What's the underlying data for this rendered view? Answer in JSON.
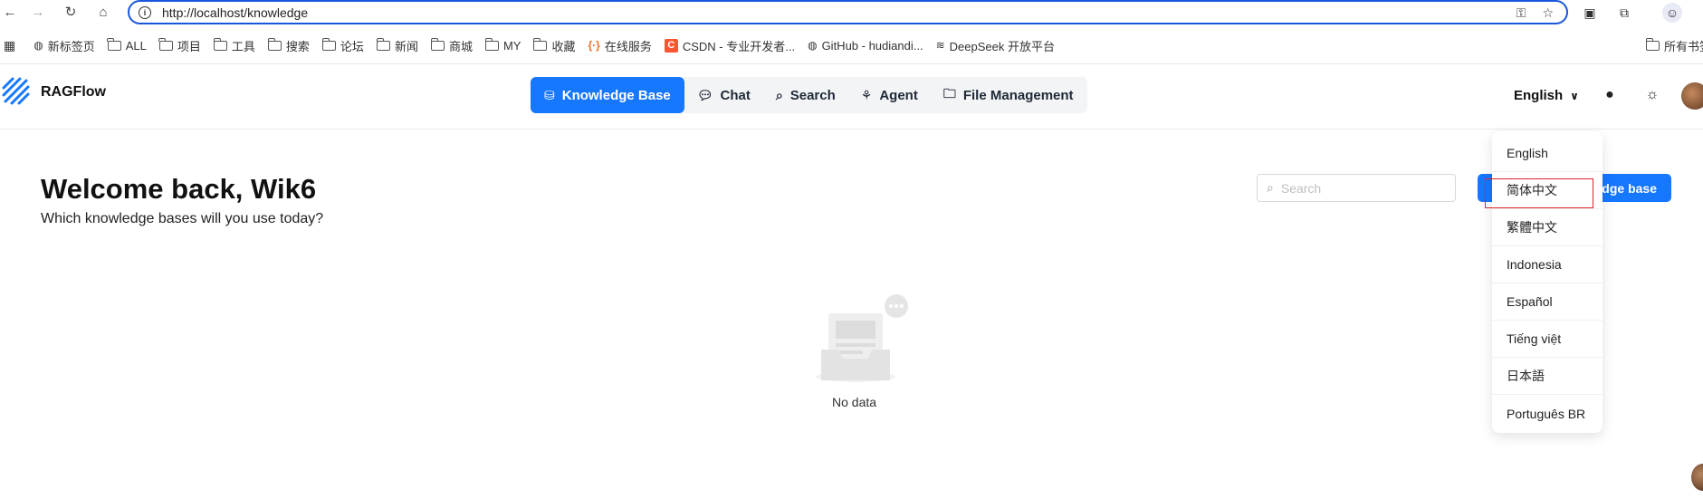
{
  "browser": {
    "url": "http://localhost/knowledge",
    "bookmarks": [
      {
        "label": "新标签页",
        "icon": "globe-icon"
      },
      {
        "label": "ALL",
        "icon": "folder-icon"
      },
      {
        "label": "项目",
        "icon": "folder-icon"
      },
      {
        "label": "工具",
        "icon": "folder-icon"
      },
      {
        "label": "搜索",
        "icon": "folder-icon"
      },
      {
        "label": "论坛",
        "icon": "folder-icon"
      },
      {
        "label": "新闻",
        "icon": "folder-icon"
      },
      {
        "label": "商城",
        "icon": "folder-icon"
      },
      {
        "label": "MY",
        "icon": "folder-icon"
      },
      {
        "label": "收藏",
        "icon": "folder-icon"
      },
      {
        "label": "在线服务",
        "icon": "bracket-icon"
      },
      {
        "label": "CSDN - 专业开发者...",
        "icon": "csdn-icon"
      },
      {
        "label": "GitHub - hudiandi...",
        "icon": "globe-icon"
      },
      {
        "label": "DeepSeek 开放平台",
        "icon": "deepseek-icon"
      }
    ],
    "all_bookmarks_label": "所有书签"
  },
  "app": {
    "name": "RAGFlow",
    "nav": [
      {
        "label": "Knowledge Base",
        "icon": "database-icon",
        "active": true
      },
      {
        "label": "Chat",
        "icon": "chat-icon",
        "active": false
      },
      {
        "label": "Search",
        "icon": "search-icon",
        "active": false
      },
      {
        "label": "Agent",
        "icon": "agent-icon",
        "active": false
      },
      {
        "label": "File Management",
        "icon": "folder-icon",
        "active": false
      }
    ],
    "language": "English"
  },
  "main": {
    "welcome": "Welcome back, Wik6",
    "subtitle": "Which knowledge bases will you use today?",
    "search_placeholder": "Search",
    "create_label": "dge base",
    "empty_text": "No data"
  },
  "language_menu": {
    "items": [
      "English",
      "简体中文",
      "繁體中文",
      "Indonesia",
      "Español",
      "Tiếng việt",
      "日本語",
      "Português BR"
    ],
    "highlighted": "简体中文"
  },
  "colors": {
    "accent": "#1677ff",
    "highlight_border": "#e0242b"
  }
}
